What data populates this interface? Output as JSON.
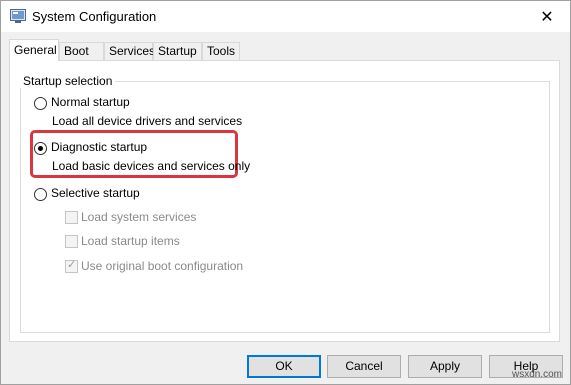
{
  "window": {
    "title": "System Configuration",
    "close_label": "✕"
  },
  "tabs": [
    {
      "label": "General",
      "active": true
    },
    {
      "label": "Boot",
      "active": false
    },
    {
      "label": "Services",
      "active": false
    },
    {
      "label": "Startup",
      "active": false
    },
    {
      "label": "Tools",
      "active": false
    }
  ],
  "startup_selection": {
    "legend": "Startup selection",
    "normal": {
      "label": "Normal startup",
      "description": "Load all device drivers and services",
      "selected": false
    },
    "diagnostic": {
      "label": "Diagnostic startup",
      "description": "Load basic devices and services only",
      "selected": true
    },
    "selective": {
      "label": "Selective startup",
      "selected": false,
      "options": [
        {
          "label": "Load system services",
          "checked": false,
          "enabled": false
        },
        {
          "label": "Load startup items",
          "checked": false,
          "enabled": false
        },
        {
          "label": "Use original boot configuration",
          "checked": true,
          "enabled": false
        }
      ]
    }
  },
  "buttons": {
    "ok": "OK",
    "cancel": "Cancel",
    "apply": "Apply",
    "help": "Help"
  },
  "highlight_color": "#d9363e",
  "watermark": "wsxdn.com"
}
